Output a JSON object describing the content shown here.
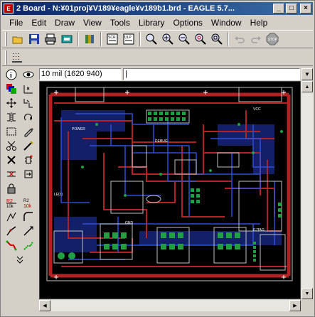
{
  "window": {
    "title": "2 Board - N:¥01proj¥V189¥eagle¥v189b1.brd - EAGLE 5.7...",
    "controls": {
      "minimize": "_",
      "maximize": "□",
      "close": "×"
    }
  },
  "menu": [
    {
      "label": "File",
      "key": "F"
    },
    {
      "label": "Edit",
      "key": "E"
    },
    {
      "label": "Draw",
      "key": "D"
    },
    {
      "label": "View",
      "key": "V"
    },
    {
      "label": "Tools",
      "key": "T"
    },
    {
      "label": "Library",
      "key": "L"
    },
    {
      "label": "Options",
      "key": "O"
    },
    {
      "label": "Window",
      "key": "W"
    },
    {
      "label": "Help",
      "key": "H"
    }
  ],
  "toolbar": {
    "buttons": [
      "open-icon",
      "save-icon",
      "print-icon",
      "cam-icon",
      "library-icon",
      "scr-icon",
      "ulp-icon",
      "zoom-fit-icon",
      "zoom-in-icon",
      "zoom-out-icon",
      "zoom-redraw-icon",
      "zoom-select-icon",
      "undo-icon",
      "redo-icon",
      "stop-icon"
    ],
    "stop_label": "STOP"
  },
  "command": {
    "coordinate": "10 mil (1620 940)",
    "input_value": "|"
  },
  "board": {
    "labels": [
      "DEBUG",
      "LED1",
      "EJTAG",
      "POWER",
      "GND",
      "VCC"
    ]
  },
  "colors": {
    "top_copper": "#b22222",
    "bottom_copper": "#2040c0",
    "pads": "#20a040",
    "silk": "#ffffff",
    "outline": "#c0c0c0"
  }
}
